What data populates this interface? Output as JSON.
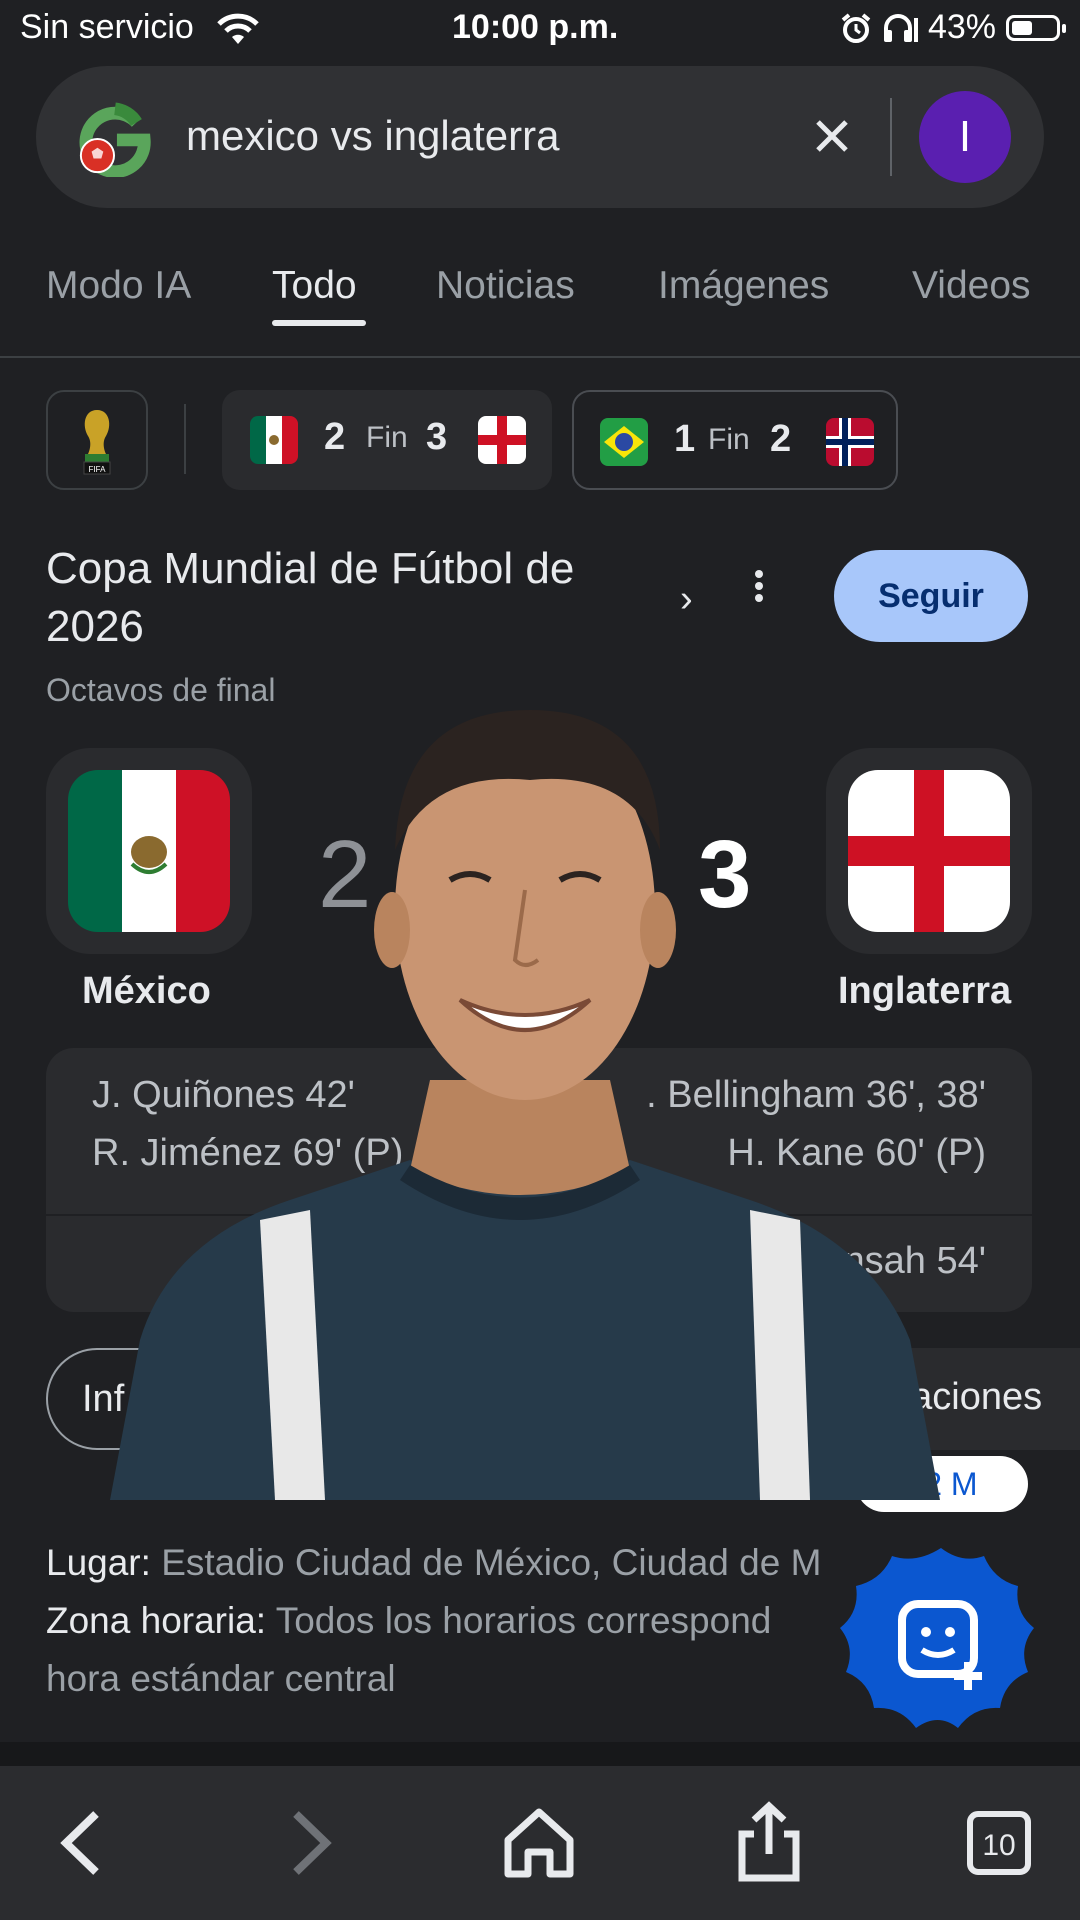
{
  "status_bar": {
    "carrier": "Sin servicio",
    "time": "10:00 p.m.",
    "battery": "43%"
  },
  "search": {
    "query": "mexico vs inglaterra",
    "clear_icon": "close-icon",
    "avatar_letter": "I",
    "avatar_color": "#5a1fb0"
  },
  "tabs": [
    {
      "label": "Modo IA"
    },
    {
      "label": "Todo",
      "active": true
    },
    {
      "label": "Noticias"
    },
    {
      "label": "Imágenes"
    },
    {
      "label": "Videos"
    }
  ],
  "chips": {
    "fifa_label": "FIFA",
    "match1": {
      "home_score": "2",
      "status": "Fin",
      "away_score": "3"
    },
    "match2": {
      "home_score": "1",
      "status": "Fin",
      "away_score": "2"
    }
  },
  "competition": {
    "title": "Copa Mundial de Fútbol de 2026",
    "follow_label": "Seguir",
    "round": "Octavos de final"
  },
  "match": {
    "home_team": "México",
    "away_team": "Inglaterra",
    "home_score": "2",
    "away_score": "3",
    "home_scorers": [
      "J. Quiñones 42'",
      "R. Jiménez 69' (P)"
    ],
    "away_scorers": [
      ". Bellingham 36', 38'",
      "H. Kane 60' (P)"
    ],
    "cards_away": "ensah 54'"
  },
  "pills": {
    "info": "Inf",
    "lineups": "eaciones",
    "viewers": "22 M"
  },
  "details": {
    "venue_label": "Lugar:",
    "venue_value": "Estadio Ciudad de México, Ciudad de M",
    "tz_label": "Zona horaria:",
    "tz_value": "Todos los horarios correspond",
    "tz_value_2": "hora estándar central"
  },
  "nav": {
    "tabs_count": "10"
  },
  "colors": {
    "accent": "#a8c7fa",
    "fab": "#0b57d0",
    "background": "#1f2023"
  }
}
